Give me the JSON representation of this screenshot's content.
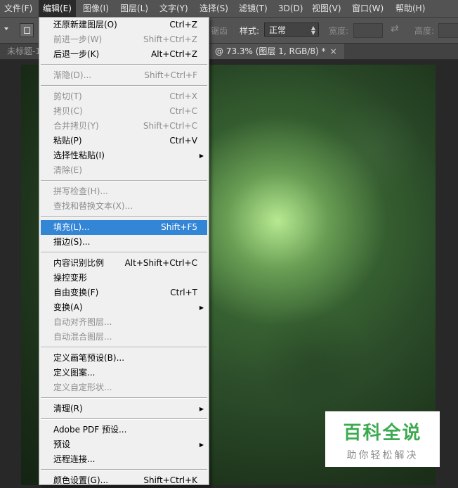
{
  "menubar": {
    "items": [
      {
        "label": "文件(F)"
      },
      {
        "label": "编辑(E)"
      },
      {
        "label": "图像(I)"
      },
      {
        "label": "图层(L)"
      },
      {
        "label": "文字(Y)"
      },
      {
        "label": "选择(S)"
      },
      {
        "label": "滤镜(T)"
      },
      {
        "label": "3D(D)"
      },
      {
        "label": "视图(V)"
      },
      {
        "label": "窗口(W)"
      },
      {
        "label": "帮助(H)"
      }
    ]
  },
  "options": {
    "faded_text": "锯齿",
    "style_label": "样式:",
    "style_value": "正常",
    "width_label": "宽度:",
    "height_label": "高度:"
  },
  "tabs": {
    "inactive": "未标题-1",
    "active": "@ 73.3% (图层 1, RGB/8) *",
    "close": "×"
  },
  "menu": {
    "items": [
      {
        "label": "还原新建图层(O)",
        "shortcut": "Ctrl+Z"
      },
      {
        "label": "前进一步(W)",
        "shortcut": "Shift+Ctrl+Z"
      },
      {
        "label": "后退一步(K)",
        "shortcut": "Alt+Ctrl+Z"
      },
      {
        "label": "渐隐(D)...",
        "shortcut": "Shift+Ctrl+F"
      },
      {
        "label": "剪切(T)",
        "shortcut": "Ctrl+X"
      },
      {
        "label": "拷贝(C)",
        "shortcut": "Ctrl+C"
      },
      {
        "label": "合并拷贝(Y)",
        "shortcut": "Shift+Ctrl+C"
      },
      {
        "label": "粘贴(P)",
        "shortcut": "Ctrl+V"
      },
      {
        "label": "选择性粘贴(I)",
        "shortcut": ""
      },
      {
        "label": "清除(E)",
        "shortcut": ""
      },
      {
        "label": "拼写检查(H)...",
        "shortcut": ""
      },
      {
        "label": "查找和替换文本(X)...",
        "shortcut": ""
      },
      {
        "label": "填充(L)...",
        "shortcut": "Shift+F5"
      },
      {
        "label": "描边(S)...",
        "shortcut": ""
      },
      {
        "label": "内容识别比例",
        "shortcut": "Alt+Shift+Ctrl+C"
      },
      {
        "label": "操控变形",
        "shortcut": ""
      },
      {
        "label": "自由变换(F)",
        "shortcut": "Ctrl+T"
      },
      {
        "label": "变换(A)",
        "shortcut": ""
      },
      {
        "label": "自动对齐图层...",
        "shortcut": ""
      },
      {
        "label": "自动混合图层...",
        "shortcut": ""
      },
      {
        "label": "定义画笔预设(B)...",
        "shortcut": ""
      },
      {
        "label": "定义图案...",
        "shortcut": ""
      },
      {
        "label": "定义自定形状...",
        "shortcut": ""
      },
      {
        "label": "清理(R)",
        "shortcut": ""
      },
      {
        "label": "Adobe PDF 预设...",
        "shortcut": ""
      },
      {
        "label": "预设",
        "shortcut": ""
      },
      {
        "label": "远程连接...",
        "shortcut": ""
      },
      {
        "label": "颜色设置(G)...",
        "shortcut": "Shift+Ctrl+K"
      }
    ]
  },
  "watermark": {
    "title": "百科全说",
    "subtitle": "助你轻松解决"
  },
  "colors": {
    "highlight": "#3385d6",
    "watermark_green": "#3cab50"
  }
}
